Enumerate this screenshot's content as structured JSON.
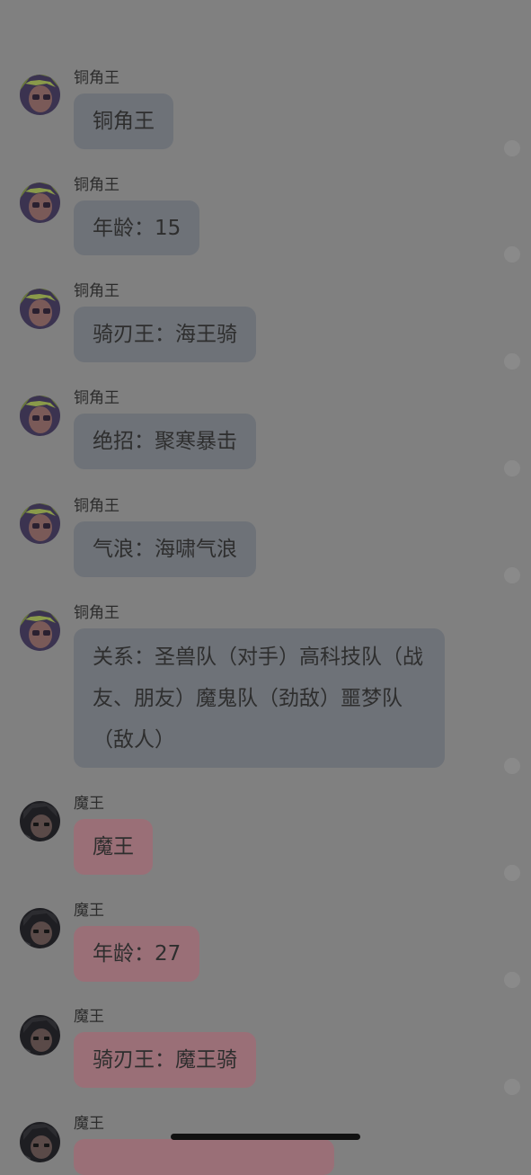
{
  "colors": {
    "overlay_background": "#808080",
    "bubble_a": "#6e7278",
    "bubble_b": "#9a6f77",
    "text": "#2e2e2e"
  },
  "messages": [
    {
      "sender": "铜角王",
      "text": "铜角王",
      "avatar": "tongjiaowang-avatar"
    },
    {
      "sender": "铜角王",
      "text": "年龄：15",
      "avatar": "tongjiaowang-avatar"
    },
    {
      "sender": "铜角王",
      "text": "骑刃王：海王骑",
      "avatar": "tongjiaowang-avatar"
    },
    {
      "sender": "铜角王",
      "text": "绝招：聚寒暴击",
      "avatar": "tongjiaowang-avatar"
    },
    {
      "sender": "铜角王",
      "text": "气浪：海啸气浪",
      "avatar": "tongjiaowang-avatar"
    },
    {
      "sender": "铜角王",
      "text": "关系：圣兽队（对手）高科技队（战友、朋友）魔鬼队（劲敌）噩梦队（敌人）",
      "avatar": "tongjiaowang-avatar"
    },
    {
      "sender": "魔王",
      "text": "魔王",
      "avatar": "mowang-avatar"
    },
    {
      "sender": "魔王",
      "text": "年龄：27",
      "avatar": "mowang-avatar"
    },
    {
      "sender": "魔王",
      "text": "骑刃王：魔王骑",
      "avatar": "mowang-avatar"
    },
    {
      "sender": "魔王",
      "text": "",
      "avatar": "mowang-avatar"
    }
  ]
}
